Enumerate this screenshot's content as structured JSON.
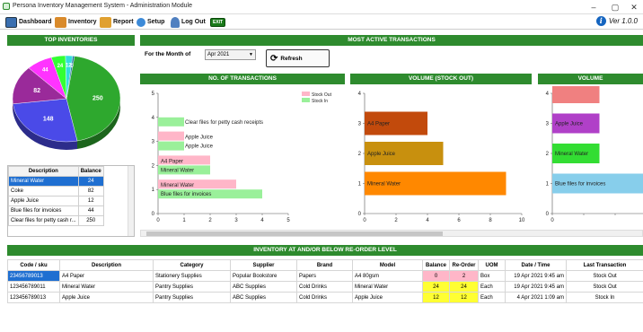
{
  "window": {
    "title": "Persona Inventory Management System - Administration Module",
    "minimize": "–",
    "maximize": "▢",
    "close": "✕"
  },
  "menu": {
    "dashboard": "Dashboard",
    "inventory": "Inventory",
    "report": "Report",
    "setup": "Setup",
    "logout": "Log Out",
    "exit_icon_text": "EXIT",
    "version": "Ver 1.0.0"
  },
  "top_inventories": {
    "title": "TOP INVENTORIES",
    "table_headers": [
      "Description",
      "Balance"
    ],
    "rows": [
      {
        "description": "Mineral Water",
        "balance": "24"
      },
      {
        "description": "Coke",
        "balance": "82"
      },
      {
        "description": "Apple Juice",
        "balance": "12"
      },
      {
        "description": "Blue files for invoices",
        "balance": "44"
      },
      {
        "description": "Clear files for petty cash r...",
        "balance": "250"
      }
    ]
  },
  "pie_chart": {
    "chart_data": {
      "type": "pie",
      "slices": [
        {
          "label": "250",
          "value": 250,
          "color": "#2ea82e"
        },
        {
          "label": "148",
          "value": 148,
          "color": "#4a4ae8"
        },
        {
          "label": "82",
          "value": 82,
          "color": "#9a2a9a"
        },
        {
          "label": "44",
          "value": 44,
          "color": "#ff33ff"
        },
        {
          "label": "24",
          "value": 24,
          "color": "#33ff33"
        },
        {
          "label": "12",
          "value": 12,
          "color": "#33dddd"
        },
        {
          "label": "0",
          "value": 3,
          "color": "#1f70a0"
        }
      ]
    }
  },
  "active": {
    "title": "MOST ACTIVE TRANSACTIONS",
    "month_label": "For the Month of",
    "month_value": "Apr 2021",
    "refresh_label": "Refresh"
  },
  "charts": {
    "transactions": {
      "title": "NO. OF TRANSACTIONS",
      "legend": [
        "Stock Out",
        "Stock In"
      ],
      "chart_data": {
        "type": "bar",
        "orientation": "horizontal",
        "xlim": [
          0,
          5
        ],
        "ylim": [
          0,
          5
        ],
        "x_ticks": [
          "0",
          "1",
          "2",
          "3",
          "4",
          "5"
        ],
        "y_ticks": [
          "0",
          "1",
          "2",
          "3",
          "4",
          "5"
        ],
        "series": [
          {
            "name": "Stock Out",
            "color": "#ffb6c8"
          },
          {
            "name": "Stock In",
            "color": "#9af09a"
          }
        ],
        "bars": [
          {
            "y": 1,
            "stock_out": 3,
            "stock_in": 4,
            "label_out": "Mineral Water",
            "label_in": "Blue files for invoices"
          },
          {
            "y": 2,
            "stock_out": 2,
            "stock_in": 2,
            "label_out": "A4 Paper",
            "label_in": "Mineral Water"
          },
          {
            "y": 3,
            "stock_out": 1,
            "stock_in": 1,
            "label_out": "Apple Juice",
            "label_in": "Apple Juice"
          },
          {
            "y": 4,
            "stock_out": 0,
            "stock_in": 1,
            "label_out": "",
            "label_in": "Clear files for petty cash receipts"
          }
        ]
      }
    },
    "volume_out": {
      "title": "VOLUME (STOCK OUT)",
      "chart_data": {
        "type": "bar",
        "orientation": "horizontal",
        "xlim": [
          0,
          10
        ],
        "ylim": [
          0,
          4
        ],
        "x_ticks": [
          "0",
          "2",
          "4",
          "6",
          "8",
          "10"
        ],
        "y_ticks": [
          "0",
          "1",
          "2",
          "3",
          "4"
        ],
        "bars": [
          {
            "y": 1,
            "value": 9,
            "label": "Mineral Water",
            "color": "#ff8800"
          },
          {
            "y": 2,
            "value": 5,
            "label": "Apple Juice",
            "color": "#c8900e"
          },
          {
            "y": 3,
            "value": 4,
            "label": "A4 Paper",
            "color": "#c24a0c"
          }
        ]
      }
    },
    "volume_in": {
      "title": "VOLUME",
      "chart_data": {
        "type": "bar",
        "orientation": "horizontal",
        "xlim": [
          0,
          10
        ],
        "ylim": [
          0,
          4
        ],
        "x_ticks": [
          "0",
          "",
          "",
          "",
          "",
          ""
        ],
        "y_ticks": [
          "0",
          "1",
          "2",
          "3",
          "4"
        ],
        "bars": [
          {
            "y": 1,
            "value": 40,
            "label": "Blue files for invoices",
            "color": "#87ceeb"
          },
          {
            "y": 2,
            "value": 12,
            "label": "Mineral Water",
            "color": "#33dd33"
          },
          {
            "y": 3,
            "value": 12,
            "label": "Apple Juice",
            "color": "#b040c8"
          },
          {
            "y": 4,
            "value": 12,
            "label": "",
            "color": "#f08080"
          }
        ]
      }
    }
  },
  "reorder": {
    "title": "INVENTORY AT AND/OR BELOW RE-ORDER LEVEL",
    "headers": [
      "Code / sku",
      "Description",
      "Category",
      "Supplier",
      "Brand",
      "Model",
      "Balance",
      "Re-Order",
      "UOM",
      "Date / Time",
      "Last Transaction"
    ],
    "rows": [
      {
        "code": "23456789013",
        "description": "A4 Paper",
        "category": "Stationery Supplies",
        "supplier": "Popular Bookstore",
        "brand": "Papers",
        "model": "A4 80gsm",
        "balance": "0",
        "reorder": "2",
        "uom": "Box",
        "datetime": "19 Apr 2021  9:45 am",
        "last": "Stock Out"
      },
      {
        "code": "123456789011",
        "description": "Mineral Water",
        "category": "Pantry Supplies",
        "supplier": "ABC Supplies",
        "brand": "Cold Drinks",
        "model": "Mineral Water",
        "balance": "24",
        "reorder": "24",
        "uom": "Each",
        "datetime": "19 Apr 2021  9:45 am",
        "last": "Stock Out"
      },
      {
        "code": "123456789013",
        "description": "Apple Juice",
        "category": "Pantry Supplies",
        "supplier": "ABC Supplies",
        "brand": "Cold Drinks",
        "model": "Apple Juice",
        "balance": "12",
        "reorder": "12",
        "uom": "Each",
        "datetime": "4 Apr 2021  1:09 am",
        "last": "Stock In"
      }
    ]
  }
}
